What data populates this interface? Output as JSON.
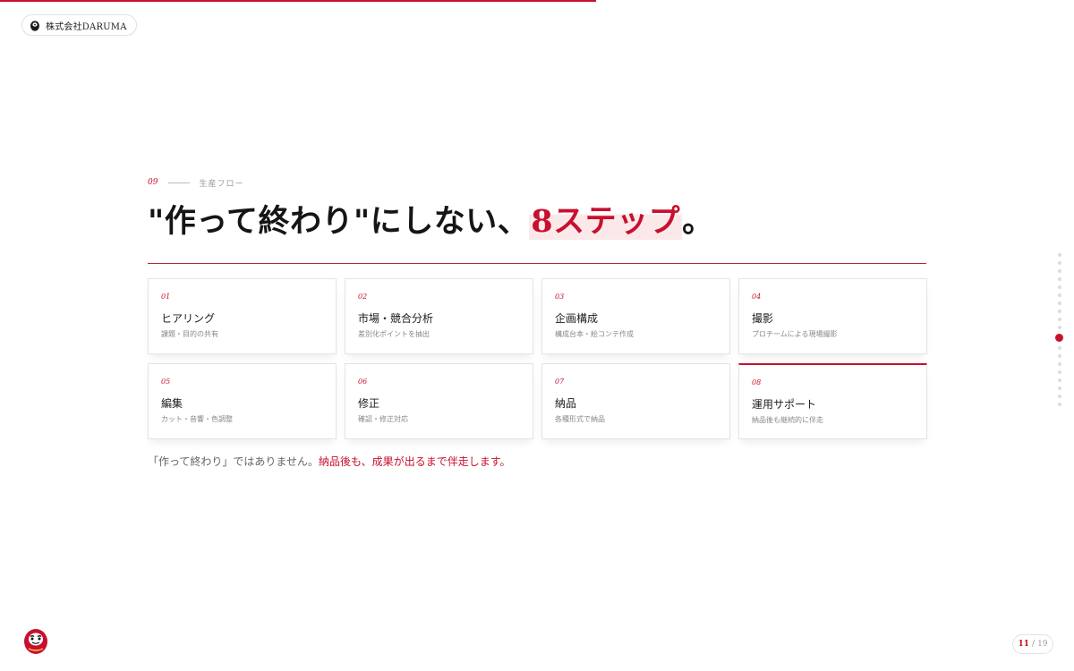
{
  "progress": {
    "value": 0.555
  },
  "brand": {
    "name": "株式会社DARUMA",
    "icon": "daruma-icon"
  },
  "section": {
    "number": "09",
    "label": "生産フロー",
    "headline": {
      "part1": "\"作って終わり\"にしない、",
      "accent": "8ステップ",
      "part2": "。"
    }
  },
  "steps": [
    {
      "number": "01",
      "title": "ヒアリング",
      "desc": "課題・目的の共有"
    },
    {
      "number": "02",
      "title": "市場・競合分析",
      "desc": "差別化ポイントを抽出"
    },
    {
      "number": "03",
      "title": "企画構成",
      "desc": "構成台本・絵コンテ作成"
    },
    {
      "number": "04",
      "title": "撮影",
      "desc": "プロチームによる現場撮影"
    },
    {
      "number": "05",
      "title": "編集",
      "desc": "カット・音響・色調整"
    },
    {
      "number": "06",
      "title": "修正",
      "desc": "確認・修正対応"
    },
    {
      "number": "07",
      "title": "納品",
      "desc": "各種形式で納品"
    },
    {
      "number": "08",
      "title": "運用サポート",
      "desc": "納品後も継続的に伴走"
    }
  ],
  "note": {
    "plain": "「作って終わり」ではありません。",
    "accent": "納品後も、成果が出るまで伴走します。"
  },
  "pagination": {
    "current": "11",
    "separator": "/",
    "total": "19"
  },
  "colors": {
    "accent": "#c8102e",
    "text": "#151515",
    "muted": "#888888"
  }
}
